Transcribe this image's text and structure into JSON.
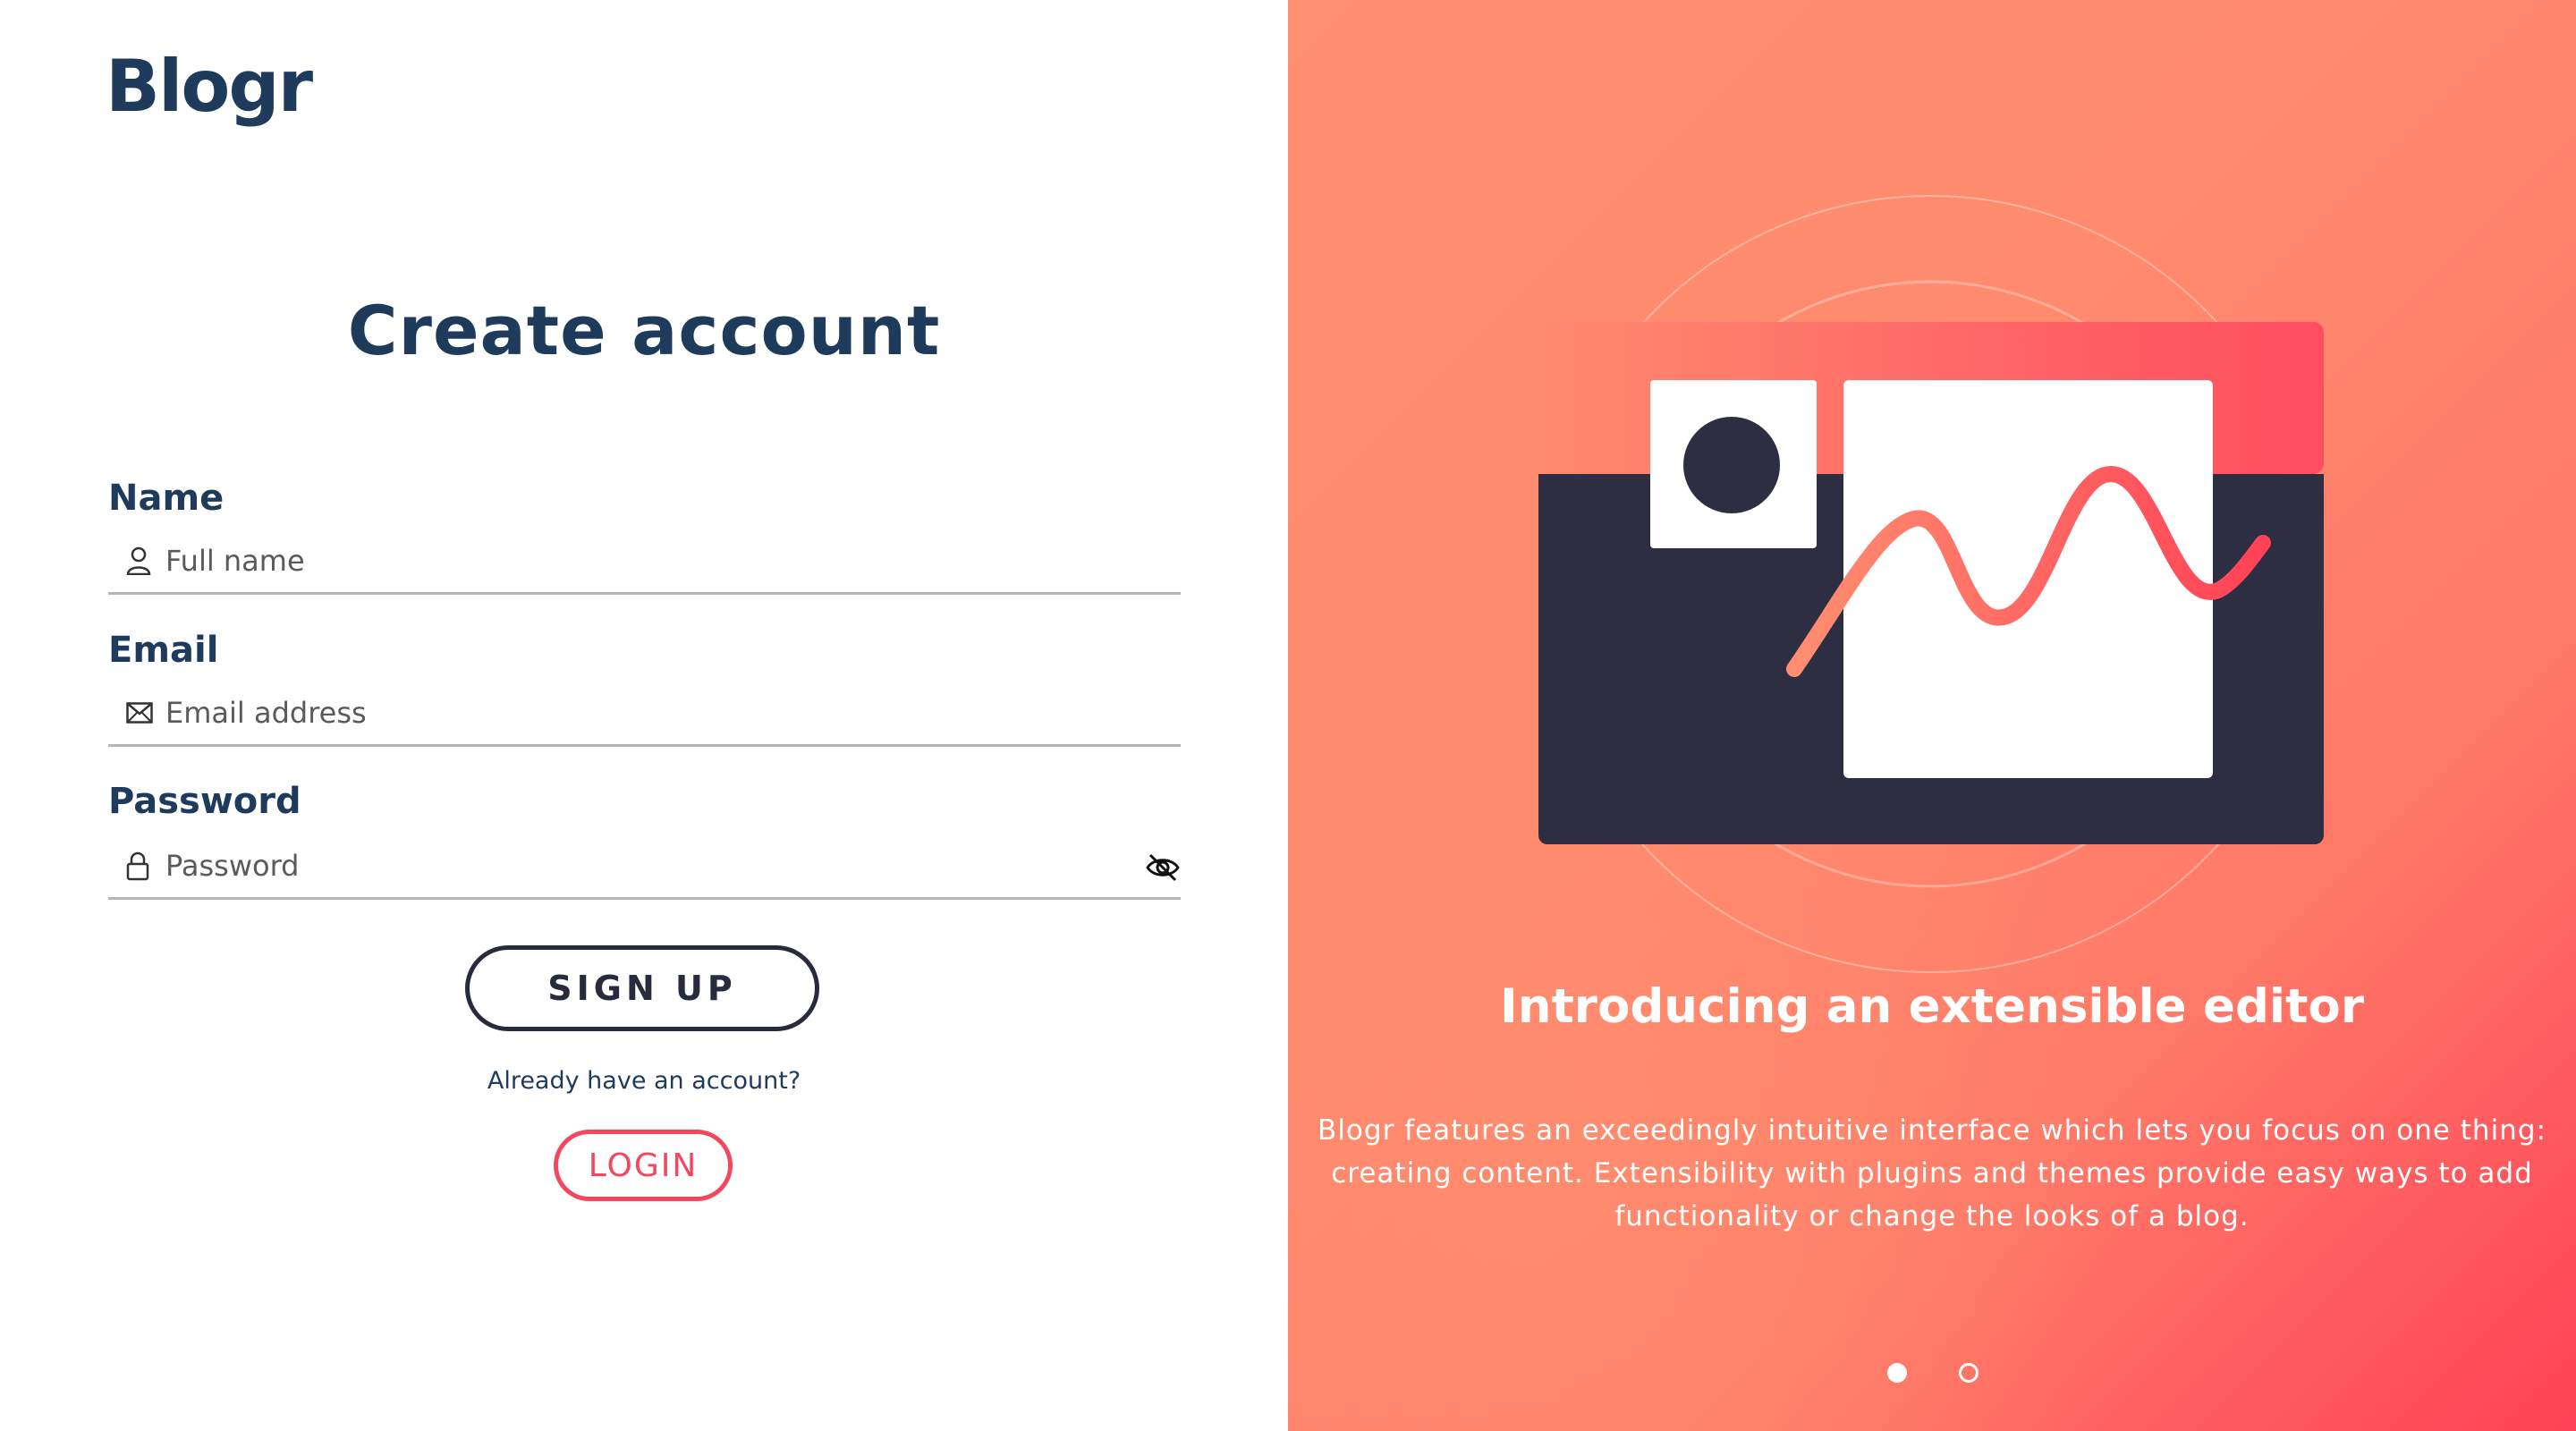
{
  "app": {
    "logo": "Blogr"
  },
  "form": {
    "title": "Create account",
    "name": {
      "label": "Name",
      "placeholder": "Full name",
      "value": ""
    },
    "email": {
      "label": "Email",
      "placeholder": "Email address",
      "value": ""
    },
    "password": {
      "label": "Password",
      "placeholder": "Password",
      "value": ""
    },
    "signup_label": "SIGN UP",
    "already_text": "Already have an account?",
    "login_label": "LOGIN"
  },
  "carousel": {
    "title": "Introducing an extensible editor",
    "description": "Blogr features an exceedingly intuitive interface which lets you focus on one thing: creating content. Extensibility with plugins and themes provide easy ways to add functionality or change the looks of a blog.",
    "active_index": 0,
    "slide_count": 2
  },
  "icons": {
    "name": "user-icon",
    "email": "envelope-icon",
    "password": "lock-icon",
    "toggle": "eye-slash-icon"
  },
  "colors": {
    "brand_dark": "#1e3b5c",
    "accent": "#f2475e",
    "button_dark": "#272b3d",
    "gradient_start": "#ff8f70",
    "gradient_end": "#ff4257"
  }
}
